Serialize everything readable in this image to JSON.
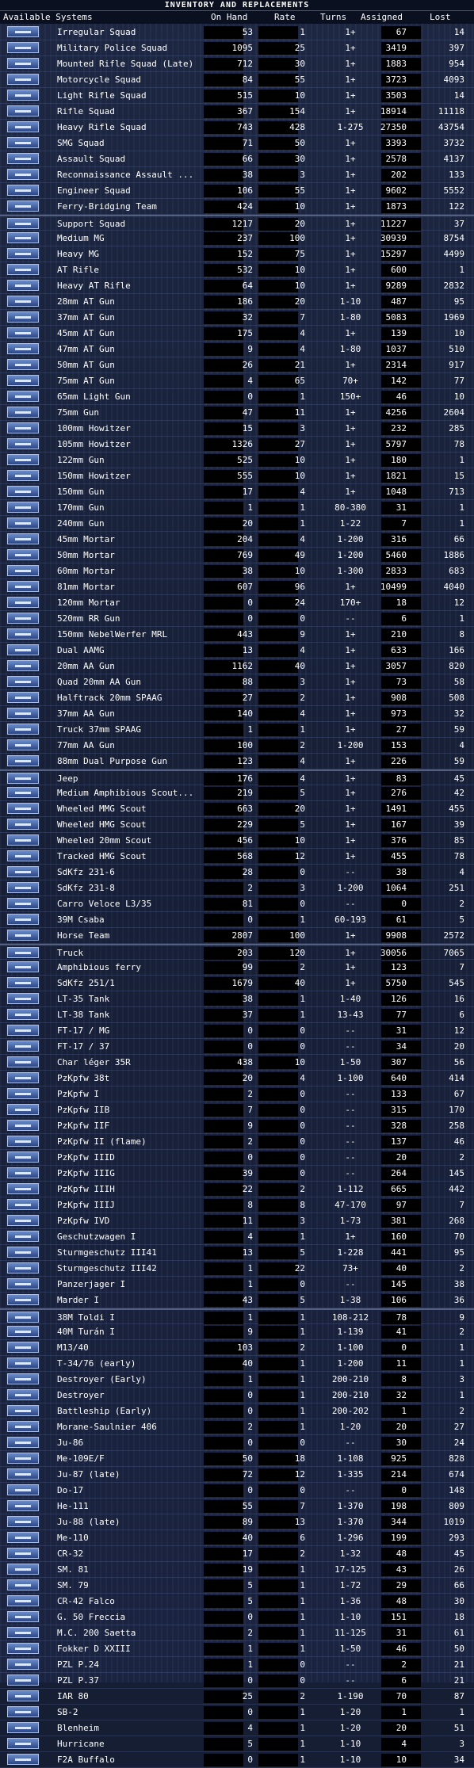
{
  "window": {
    "title": "INVENTORY AND REPLACEMENTS"
  },
  "columns": {
    "name": "Available Systems",
    "on_hand": "On Hand",
    "rate": "Rate",
    "turns": "Turns",
    "assigned": "Assigned",
    "lost": "Lost"
  },
  "rows": [
    {
      "name": "Irregular Squad",
      "on_hand": "53",
      "rate": "1",
      "turns": "1+",
      "assigned": "67",
      "lost": "14"
    },
    {
      "name": "Military Police Squad",
      "on_hand": "1095",
      "rate": "25",
      "turns": "1+",
      "assigned": "3419",
      "lost": "397"
    },
    {
      "name": "Mounted Rifle Squad (Late)",
      "on_hand": "712",
      "rate": "30",
      "turns": "1+",
      "assigned": "1883",
      "lost": "954"
    },
    {
      "name": "Motorcycle Squad",
      "on_hand": "84",
      "rate": "55",
      "turns": "1+",
      "assigned": "3723",
      "lost": "4093"
    },
    {
      "name": "Light Rifle Squad",
      "on_hand": "515",
      "rate": "10",
      "turns": "1+",
      "assigned": "3503",
      "lost": "14"
    },
    {
      "name": "Rifle Squad",
      "on_hand": "367",
      "rate": "154",
      "turns": "1+",
      "assigned": "18914",
      "lost": "11118"
    },
    {
      "name": "Heavy Rifle Squad",
      "on_hand": "743",
      "rate": "428",
      "turns": "1-275",
      "assigned": "27350",
      "lost": "43754"
    },
    {
      "name": "SMG Squad",
      "on_hand": "71",
      "rate": "50",
      "turns": "1+",
      "assigned": "3393",
      "lost": "3732"
    },
    {
      "name": "Assault Squad",
      "on_hand": "66",
      "rate": "30",
      "turns": "1+",
      "assigned": "2578",
      "lost": "4137"
    },
    {
      "name": "Reconnaissance Assault ...",
      "on_hand": "38",
      "rate": "3",
      "turns": "1+",
      "assigned": "202",
      "lost": "133"
    },
    {
      "name": "Engineer Squad",
      "on_hand": "106",
      "rate": "55",
      "turns": "1+",
      "assigned": "9602",
      "lost": "5552"
    },
    {
      "name": "Ferry-Bridging Team",
      "on_hand": "424",
      "rate": "10",
      "turns": "1+",
      "assigned": "1873",
      "lost": "122"
    },
    {
      "name": "Support Squad",
      "on_hand": "1217",
      "rate": "20",
      "turns": "1+",
      "assigned": "11227",
      "lost": "37",
      "sep": true
    },
    {
      "name": "Medium MG",
      "on_hand": "237",
      "rate": "100",
      "turns": "1+",
      "assigned": "30939",
      "lost": "8754"
    },
    {
      "name": "Heavy MG",
      "on_hand": "152",
      "rate": "75",
      "turns": "1+",
      "assigned": "15297",
      "lost": "4499"
    },
    {
      "name": "AT Rifle",
      "on_hand": "532",
      "rate": "10",
      "turns": "1+",
      "assigned": "600",
      "lost": "1"
    },
    {
      "name": "Heavy AT Rifle",
      "on_hand": "64",
      "rate": "10",
      "turns": "1+",
      "assigned": "9289",
      "lost": "2832"
    },
    {
      "name": "28mm AT Gun",
      "on_hand": "186",
      "rate": "20",
      "turns": "1-10",
      "assigned": "487",
      "lost": "95"
    },
    {
      "name": "37mm AT Gun",
      "on_hand": "32",
      "rate": "7",
      "turns": "1-80",
      "assigned": "5083",
      "lost": "1969"
    },
    {
      "name": "45mm AT Gun",
      "on_hand": "175",
      "rate": "4",
      "turns": "1+",
      "assigned": "139",
      "lost": "10"
    },
    {
      "name": "47mm AT Gun",
      "on_hand": "9",
      "rate": "4",
      "turns": "1-80",
      "assigned": "1037",
      "lost": "510"
    },
    {
      "name": "50mm AT Gun",
      "on_hand": "26",
      "rate": "21",
      "turns": "1+",
      "assigned": "2314",
      "lost": "917"
    },
    {
      "name": "75mm AT Gun",
      "on_hand": "4",
      "rate": "65",
      "turns": "70+",
      "assigned": "142",
      "lost": "77"
    },
    {
      "name": "65mm Light Gun",
      "on_hand": "0",
      "rate": "1",
      "turns": "150+",
      "assigned": "46",
      "lost": "10"
    },
    {
      "name": "75mm Gun",
      "on_hand": "47",
      "rate": "11",
      "turns": "1+",
      "assigned": "4256",
      "lost": "2604"
    },
    {
      "name": "100mm Howitzer",
      "on_hand": "15",
      "rate": "3",
      "turns": "1+",
      "assigned": "232",
      "lost": "285"
    },
    {
      "name": "105mm Howitzer",
      "on_hand": "1326",
      "rate": "27",
      "turns": "1+",
      "assigned": "5797",
      "lost": "78"
    },
    {
      "name": "122mm Gun",
      "on_hand": "525",
      "rate": "10",
      "turns": "1+",
      "assigned": "180",
      "lost": "1"
    },
    {
      "name": "150mm Howitzer",
      "on_hand": "555",
      "rate": "10",
      "turns": "1+",
      "assigned": "1821",
      "lost": "15"
    },
    {
      "name": "150mm Gun",
      "on_hand": "17",
      "rate": "4",
      "turns": "1+",
      "assigned": "1048",
      "lost": "713"
    },
    {
      "name": "170mm Gun",
      "on_hand": "1",
      "rate": "1",
      "turns": "80-380",
      "assigned": "31",
      "lost": "1"
    },
    {
      "name": "240mm Gun",
      "on_hand": "20",
      "rate": "1",
      "turns": "1-22",
      "assigned": "7",
      "lost": "1"
    },
    {
      "name": "45mm Mortar",
      "on_hand": "204",
      "rate": "4",
      "turns": "1-200",
      "assigned": "316",
      "lost": "66"
    },
    {
      "name": "50mm Mortar",
      "on_hand": "769",
      "rate": "49",
      "turns": "1-200",
      "assigned": "5460",
      "lost": "1886"
    },
    {
      "name": "60mm Mortar",
      "on_hand": "38",
      "rate": "10",
      "turns": "1-300",
      "assigned": "2833",
      "lost": "683"
    },
    {
      "name": "81mm Mortar",
      "on_hand": "607",
      "rate": "96",
      "turns": "1+",
      "assigned": "10499",
      "lost": "4040"
    },
    {
      "name": "120mm Mortar",
      "on_hand": "0",
      "rate": "24",
      "turns": "170+",
      "assigned": "18",
      "lost": "12"
    },
    {
      "name": "520mm RR Gun",
      "on_hand": "0",
      "rate": "0",
      "turns": "--",
      "assigned": "6",
      "lost": "1"
    },
    {
      "name": "150mm NebelWerfer MRL",
      "on_hand": "443",
      "rate": "9",
      "turns": "1+",
      "assigned": "210",
      "lost": "8"
    },
    {
      "name": "Dual AAMG",
      "on_hand": "13",
      "rate": "4",
      "turns": "1+",
      "assigned": "633",
      "lost": "166"
    },
    {
      "name": "20mm AA Gun",
      "on_hand": "1162",
      "rate": "40",
      "turns": "1+",
      "assigned": "3057",
      "lost": "820"
    },
    {
      "name": "Quad 20mm AA Gun",
      "on_hand": "88",
      "rate": "3",
      "turns": "1+",
      "assigned": "73",
      "lost": "58"
    },
    {
      "name": "Halftrack 20mm SPAAG",
      "on_hand": "27",
      "rate": "2",
      "turns": "1+",
      "assigned": "908",
      "lost": "508"
    },
    {
      "name": "37mm AA Gun",
      "on_hand": "140",
      "rate": "4",
      "turns": "1+",
      "assigned": "973",
      "lost": "32"
    },
    {
      "name": "Truck 37mm SPAAG",
      "on_hand": "1",
      "rate": "1",
      "turns": "1+",
      "assigned": "27",
      "lost": "59"
    },
    {
      "name": "77mm AA Gun",
      "on_hand": "100",
      "rate": "2",
      "turns": "1-200",
      "assigned": "153",
      "lost": "4"
    },
    {
      "name": "88mm Dual Purpose Gun",
      "on_hand": "123",
      "rate": "4",
      "turns": "1+",
      "assigned": "226",
      "lost": "59"
    },
    {
      "name": "Jeep",
      "on_hand": "176",
      "rate": "4",
      "turns": "1+",
      "assigned": "83",
      "lost": "45",
      "sep": true
    },
    {
      "name": "Medium Amphibious Scout...",
      "on_hand": "219",
      "rate": "5",
      "turns": "1+",
      "assigned": "276",
      "lost": "42"
    },
    {
      "name": "Wheeled MMG Scout",
      "on_hand": "663",
      "rate": "20",
      "turns": "1+",
      "assigned": "1491",
      "lost": "455"
    },
    {
      "name": "Wheeled HMG Scout",
      "on_hand": "229",
      "rate": "5",
      "turns": "1+",
      "assigned": "167",
      "lost": "39"
    },
    {
      "name": "Wheeled 20mm Scout",
      "on_hand": "456",
      "rate": "10",
      "turns": "1+",
      "assigned": "376",
      "lost": "85"
    },
    {
      "name": "Tracked HMG Scout",
      "on_hand": "568",
      "rate": "12",
      "turns": "1+",
      "assigned": "455",
      "lost": "78"
    },
    {
      "name": "SdKfz 231-6",
      "on_hand": "28",
      "rate": "0",
      "turns": "--",
      "assigned": "38",
      "lost": "4"
    },
    {
      "name": "SdKfz 231-8",
      "on_hand": "2",
      "rate": "3",
      "turns": "1-200",
      "assigned": "1064",
      "lost": "251"
    },
    {
      "name": "Carro Veloce L3/35",
      "on_hand": "81",
      "rate": "0",
      "turns": "--",
      "assigned": "0",
      "lost": "2"
    },
    {
      "name": "39M Csaba",
      "on_hand": "0",
      "rate": "1",
      "turns": "60-193",
      "assigned": "61",
      "lost": "5"
    },
    {
      "name": "Horse Team",
      "on_hand": "2807",
      "rate": "100",
      "turns": "1+",
      "assigned": "9908",
      "lost": "2572"
    },
    {
      "name": "Truck",
      "on_hand": "203",
      "rate": "120",
      "turns": "1+",
      "assigned": "30056",
      "lost": "7065",
      "sep": true
    },
    {
      "name": "Amphibious ferry",
      "on_hand": "99",
      "rate": "2",
      "turns": "1+",
      "assigned": "123",
      "lost": "7"
    },
    {
      "name": "SdKfz 251/1",
      "on_hand": "1679",
      "rate": "40",
      "turns": "1+",
      "assigned": "5750",
      "lost": "545"
    },
    {
      "name": "LT-35 Tank",
      "on_hand": "38",
      "rate": "1",
      "turns": "1-40",
      "assigned": "126",
      "lost": "16"
    },
    {
      "name": "LT-38 Tank",
      "on_hand": "37",
      "rate": "1",
      "turns": "13-43",
      "assigned": "77",
      "lost": "6"
    },
    {
      "name": "FT-17 / MG",
      "on_hand": "0",
      "rate": "0",
      "turns": "--",
      "assigned": "31",
      "lost": "12"
    },
    {
      "name": "FT-17 / 37",
      "on_hand": "0",
      "rate": "0",
      "turns": "--",
      "assigned": "34",
      "lost": "20"
    },
    {
      "name": "Char léger 35R",
      "on_hand": "438",
      "rate": "10",
      "turns": "1-50",
      "assigned": "307",
      "lost": "56"
    },
    {
      "name": "PzKpfw 38t",
      "on_hand": "20",
      "rate": "4",
      "turns": "1-100",
      "assigned": "640",
      "lost": "414"
    },
    {
      "name": "PzKpfw I",
      "on_hand": "2",
      "rate": "0",
      "turns": "--",
      "assigned": "133",
      "lost": "67"
    },
    {
      "name": "PzKpfw IIB",
      "on_hand": "7",
      "rate": "0",
      "turns": "--",
      "assigned": "315",
      "lost": "170"
    },
    {
      "name": "PzKpfw IIF",
      "on_hand": "9",
      "rate": "0",
      "turns": "--",
      "assigned": "328",
      "lost": "258"
    },
    {
      "name": "PzKpfw II (flame)",
      "on_hand": "2",
      "rate": "0",
      "turns": "--",
      "assigned": "137",
      "lost": "46"
    },
    {
      "name": "PzKpfw IIID",
      "on_hand": "0",
      "rate": "0",
      "turns": "--",
      "assigned": "20",
      "lost": "2"
    },
    {
      "name": "PzKpfw IIIG",
      "on_hand": "39",
      "rate": "0",
      "turns": "--",
      "assigned": "264",
      "lost": "145"
    },
    {
      "name": "PzKpfw IIIH",
      "on_hand": "22",
      "rate": "2",
      "turns": "1-112",
      "assigned": "665",
      "lost": "442"
    },
    {
      "name": "PzKpfw IIIJ",
      "on_hand": "8",
      "rate": "8",
      "turns": "47-170",
      "assigned": "97",
      "lost": "7"
    },
    {
      "name": "PzKpfw IVD",
      "on_hand": "11",
      "rate": "3",
      "turns": "1-73",
      "assigned": "381",
      "lost": "268"
    },
    {
      "name": "Geschutzwagen I",
      "on_hand": "4",
      "rate": "1",
      "turns": "1+",
      "assigned": "160",
      "lost": "70"
    },
    {
      "name": "Sturmgeschutz III41",
      "on_hand": "13",
      "rate": "5",
      "turns": "1-228",
      "assigned": "441",
      "lost": "95"
    },
    {
      "name": "Sturmgeschutz III42",
      "on_hand": "1",
      "rate": "22",
      "turns": "73+",
      "assigned": "40",
      "lost": "2"
    },
    {
      "name": "Panzerjager I",
      "on_hand": "1",
      "rate": "0",
      "turns": "--",
      "assigned": "145",
      "lost": "38"
    },
    {
      "name": "Marder I",
      "on_hand": "43",
      "rate": "5",
      "turns": "1-38",
      "assigned": "106",
      "lost": "36"
    },
    {
      "name": "38M Toldi I",
      "on_hand": "1",
      "rate": "1",
      "turns": "108-212",
      "assigned": "78",
      "lost": "9",
      "sep": true
    },
    {
      "name": "40M Turán I",
      "on_hand": "9",
      "rate": "1",
      "turns": "1-139",
      "assigned": "41",
      "lost": "2"
    },
    {
      "name": "M13/40",
      "on_hand": "103",
      "rate": "2",
      "turns": "1-100",
      "assigned": "0",
      "lost": "1"
    },
    {
      "name": "T-34/76 (early)",
      "on_hand": "40",
      "rate": "1",
      "turns": "1-200",
      "assigned": "11",
      "lost": "1"
    },
    {
      "name": "Destroyer (Early)",
      "on_hand": "1",
      "rate": "1",
      "turns": "200-210",
      "assigned": "8",
      "lost": "3"
    },
    {
      "name": "Destroyer",
      "on_hand": "0",
      "rate": "1",
      "turns": "200-210",
      "assigned": "32",
      "lost": "1"
    },
    {
      "name": "Battleship (Early)",
      "on_hand": "0",
      "rate": "1",
      "turns": "200-202",
      "assigned": "1",
      "lost": "2"
    },
    {
      "name": "Morane-Saulnier 406",
      "on_hand": "2",
      "rate": "1",
      "turns": "1-20",
      "assigned": "20",
      "lost": "27"
    },
    {
      "name": "Ju-86",
      "on_hand": "0",
      "rate": "0",
      "turns": "--",
      "assigned": "30",
      "lost": "24"
    },
    {
      "name": "Me-109E/F",
      "on_hand": "50",
      "rate": "18",
      "turns": "1-108",
      "assigned": "925",
      "lost": "828"
    },
    {
      "name": "Ju-87 (late)",
      "on_hand": "72",
      "rate": "12",
      "turns": "1-335",
      "assigned": "214",
      "lost": "674"
    },
    {
      "name": "Do-17",
      "on_hand": "0",
      "rate": "0",
      "turns": "--",
      "assigned": "0",
      "lost": "148"
    },
    {
      "name": "He-111",
      "on_hand": "55",
      "rate": "7",
      "turns": "1-370",
      "assigned": "198",
      "lost": "809"
    },
    {
      "name": "Ju-88 (late)",
      "on_hand": "89",
      "rate": "13",
      "turns": "1-370",
      "assigned": "344",
      "lost": "1019"
    },
    {
      "name": "Me-110",
      "on_hand": "40",
      "rate": "6",
      "turns": "1-296",
      "assigned": "199",
      "lost": "293"
    },
    {
      "name": "CR-32",
      "on_hand": "17",
      "rate": "2",
      "turns": "1-32",
      "assigned": "48",
      "lost": "45"
    },
    {
      "name": "SM. 81",
      "on_hand": "19",
      "rate": "1",
      "turns": "17-125",
      "assigned": "43",
      "lost": "26"
    },
    {
      "name": "SM. 79",
      "on_hand": "5",
      "rate": "1",
      "turns": "1-72",
      "assigned": "29",
      "lost": "66"
    },
    {
      "name": "CR-42 Falco",
      "on_hand": "5",
      "rate": "1",
      "turns": "1-36",
      "assigned": "48",
      "lost": "30"
    },
    {
      "name": "G. 50 Freccia",
      "on_hand": "0",
      "rate": "1",
      "turns": "1-10",
      "assigned": "151",
      "lost": "18"
    },
    {
      "name": "M.C. 200 Saetta",
      "on_hand": "2",
      "rate": "1",
      "turns": "11-125",
      "assigned": "31",
      "lost": "61"
    },
    {
      "name": "Fokker D XXIII",
      "on_hand": "1",
      "rate": "1",
      "turns": "1-50",
      "assigned": "46",
      "lost": "50"
    },
    {
      "name": "PZL P.24",
      "on_hand": "1",
      "rate": "0",
      "turns": "--",
      "assigned": "2",
      "lost": "21"
    },
    {
      "name": "PZL P.37",
      "on_hand": "0",
      "rate": "0",
      "turns": "--",
      "assigned": "6",
      "lost": "21"
    },
    {
      "name": "IAR 80",
      "on_hand": "25",
      "rate": "2",
      "turns": "1-190",
      "assigned": "70",
      "lost": "87"
    },
    {
      "name": "SB-2",
      "on_hand": "0",
      "rate": "1",
      "turns": "1-20",
      "assigned": "1",
      "lost": "1"
    },
    {
      "name": "Blenheim",
      "on_hand": "4",
      "rate": "1",
      "turns": "1-20",
      "assigned": "20",
      "lost": "51"
    },
    {
      "name": "Hurricane",
      "on_hand": "5",
      "rate": "1",
      "turns": "1-10",
      "assigned": "4",
      "lost": "3"
    },
    {
      "name": "F2A Buffalo",
      "on_hand": "0",
      "rate": "1",
      "turns": "1-10",
      "assigned": "10",
      "lost": "34"
    }
  ]
}
